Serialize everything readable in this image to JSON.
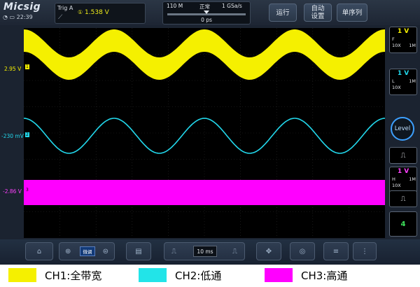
{
  "app": {
    "logo": "Micsig",
    "clock": "22:39"
  },
  "trigger": {
    "title": "Trig  A",
    "level": "1.538  V",
    "edge_icon": "rising-edge-icon"
  },
  "timebase": {
    "memory": "110 M",
    "mode": "正常",
    "sample_rate": "1 GSa/s",
    "delay": "0 ps"
  },
  "buttons": {
    "run": "运行",
    "auto_setup": "自动\n设置",
    "single": "单序列",
    "level": "Level",
    "fine": "微调",
    "time_div": "10 ms"
  },
  "channels": [
    {
      "name": "CH1",
      "scale": "1 V",
      "coupling": "F",
      "impedance": "1M",
      "probe": "10X",
      "offset_label": "2.95 V",
      "color": "#f5f000"
    },
    {
      "name": "CH2",
      "scale": "1 V",
      "coupling": "L",
      "impedance": "1M",
      "probe": "10X",
      "offset_label": "-230 mV",
      "color": "#22d8ec"
    },
    {
      "name": "CH3",
      "scale": "1 V",
      "coupling": "H",
      "impedance": "1M",
      "probe": "10X",
      "offset_label": "-2.86 V",
      "color": "#ff00ff"
    }
  ],
  "channel4_button": "4",
  "legend": [
    {
      "label": "CH1:全带宽",
      "color": "#f5f000"
    },
    {
      "label": "CH2:低通",
      "color": "#22d8ec"
    },
    {
      "label": "CH3:高通",
      "color": "#ff00ff"
    }
  ]
}
